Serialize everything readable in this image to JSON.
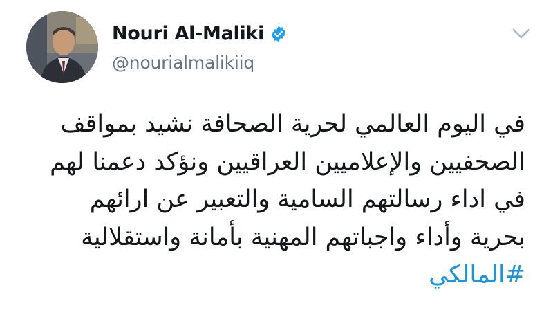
{
  "tweet": {
    "author": {
      "display_name": "Nouri Al-Maliki",
      "handle": "@nourialmalikiiq",
      "verified": true
    },
    "text_lines": [
      "في اليوم العالمي لحرية الصحافة نشيد بمواقف",
      "الصحفيين والإعلاميين العراقيين ونؤكد دعمنا لهم",
      "في اداء رسالتهم السامية والتعبير عن ارائهم",
      "بحرية وأداء واجباتهم المهنية بأمانة واستقلالية"
    ],
    "hashtag": "#المالكي"
  },
  "icons": {
    "verified": "verified-badge-icon",
    "menu": "chevron-down-icon"
  },
  "colors": {
    "name": "#14171a",
    "handle": "#657786",
    "link": "#1b95e0",
    "verified": "#1da1f2",
    "caret": "#aab8c2"
  }
}
